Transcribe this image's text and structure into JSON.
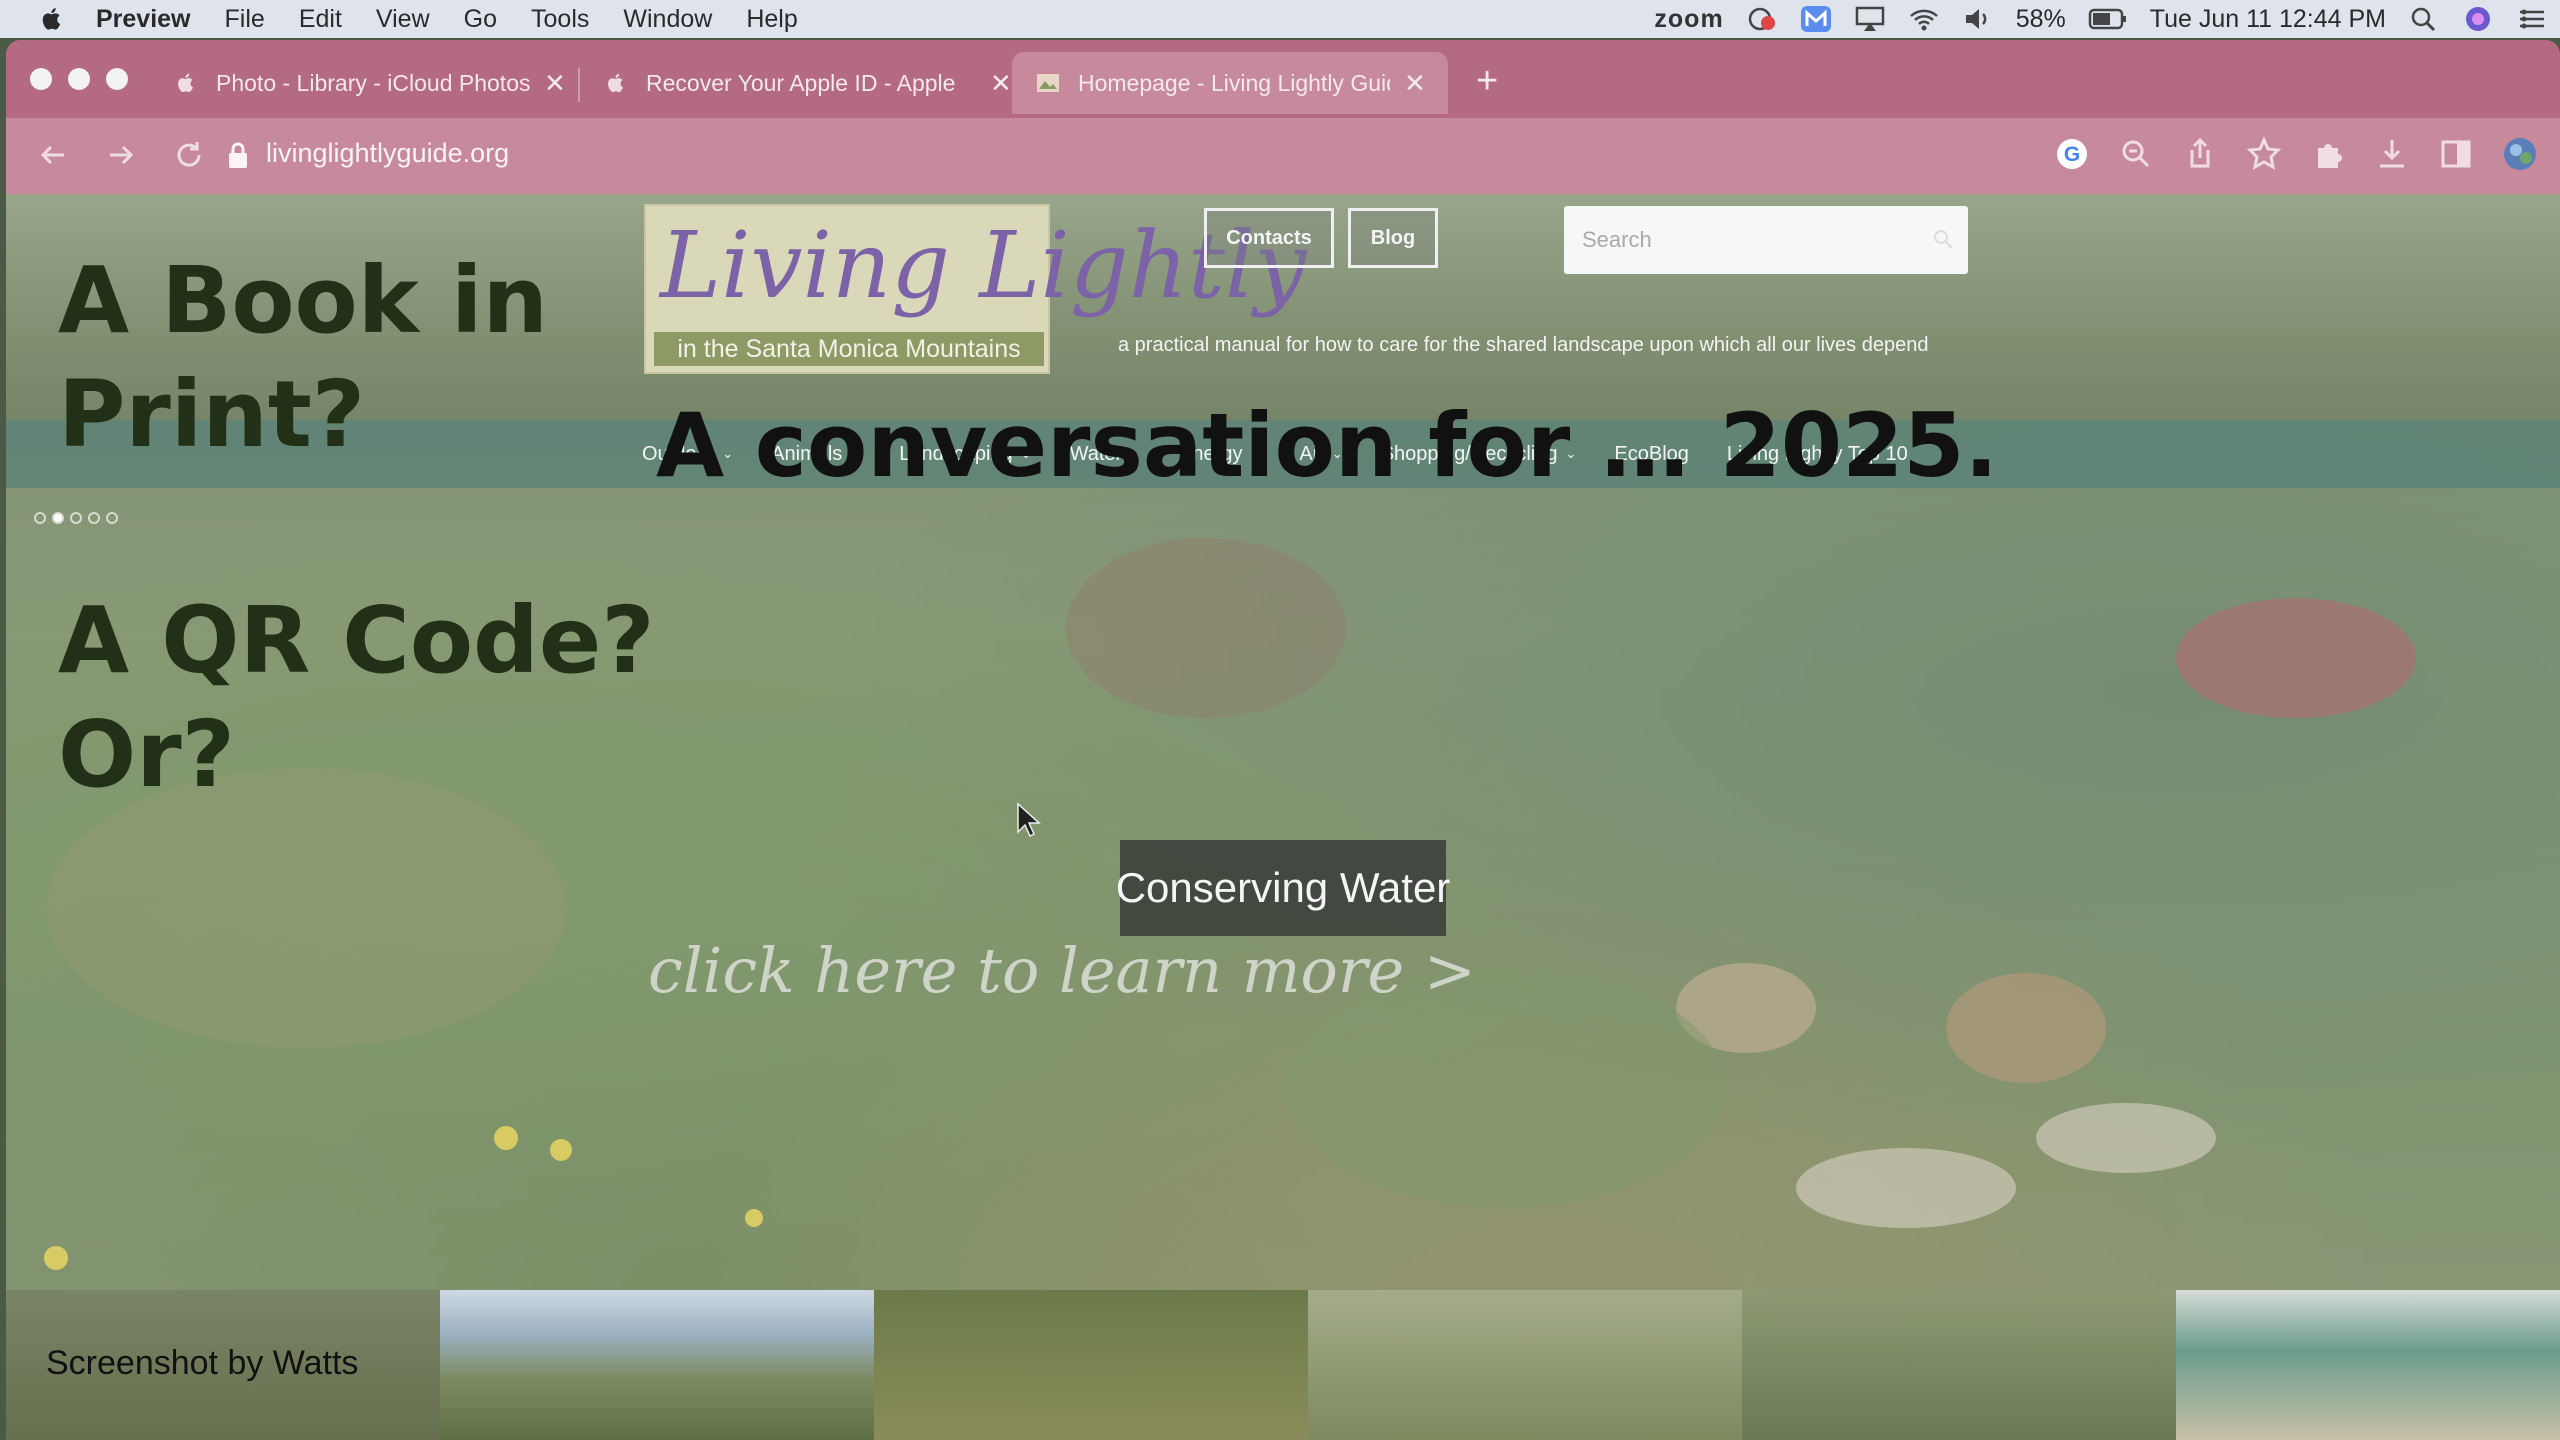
{
  "menubar": {
    "app_name": "Preview",
    "menus": [
      "File",
      "Edit",
      "View",
      "Go",
      "Tools",
      "Window",
      "Help"
    ],
    "zoom_label": "zoom",
    "battery": "58%",
    "datetime": "Tue Jun 11  12:44 PM"
  },
  "browser": {
    "tabs": [
      {
        "title": "Photo - Library - iCloud Photos",
        "active": false
      },
      {
        "title": "Recover Your Apple ID - Apple",
        "active": false
      },
      {
        "title": "Homepage - Living Lightly Guide",
        "active": true
      }
    ],
    "url": "livinglightlyguide.org"
  },
  "site": {
    "logo_script": "Living Lightly",
    "logo_sub": "in the Santa Monica Mountains",
    "header_buttons": [
      "Contacts",
      "Blog"
    ],
    "search_placeholder": "Search",
    "tagline": "a practical manual for how to care for the shared landscape upon which all our lives depend",
    "nav": [
      {
        "label": "Outdoor",
        "dropdown": true
      },
      {
        "label": "Animals",
        "dropdown": true
      },
      {
        "label": "Landscaping",
        "dropdown": true
      },
      {
        "label": "Water",
        "dropdown": true
      },
      {
        "label": "Energy",
        "dropdown": true
      },
      {
        "label": "Air",
        "dropdown": true
      },
      {
        "label": "Shopping/Recycling",
        "dropdown": true
      },
      {
        "label": "EcoBlog",
        "dropdown": false
      },
      {
        "label": "Living Lightly Top 10",
        "dropdown": false
      }
    ],
    "hero_button": "Conserving Water",
    "hero_link": "click here to learn more >"
  },
  "overlay_text": {
    "book_line1": "A Book in",
    "book_line2": "Print?",
    "qr_line1": "A QR Code?",
    "qr_line2": "Or?",
    "conversation": "A conversation for … 2025.",
    "credit": "Screenshot by Watts"
  },
  "colors": {
    "tab_bar": "#b46a82",
    "toolbar": "#c68a9c",
    "nav_bar": "#58807a",
    "overlay_text": "#223017"
  }
}
